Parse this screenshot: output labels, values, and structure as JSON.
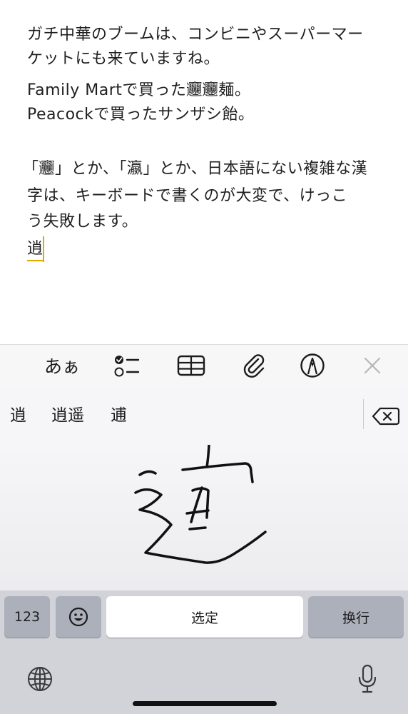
{
  "note": {
    "lines": [
      "ガチ中華のブームは、コンビニやスーパーマー",
      "ケットにも来ていますね。",
      "Family Martで買った𰻞𰻞麺。",
      "Peacockで買ったサンザシ飴。",
      "「𰻞」とか、「瀛」とか、日本語にない複雑な漢",
      "字は、キーボードで書くのが大変で、けっこ",
      "う失敗します。"
    ],
    "composing_char": "逍"
  },
  "toolbar": {
    "text_format_label": "あぁ",
    "icons": [
      "checklist-icon",
      "table-icon",
      "paperclip-icon",
      "markup-pen-icon",
      "close-icon"
    ]
  },
  "keyboard": {
    "candidates": [
      "逍",
      "逍遥",
      "逋"
    ],
    "keys": {
      "numbers_label": "123",
      "confirm_label": "选定",
      "return_label": "换行"
    },
    "icons": [
      "delete-icon",
      "emoji-icon",
      "globe-icon",
      "microphone-icon"
    ]
  }
}
